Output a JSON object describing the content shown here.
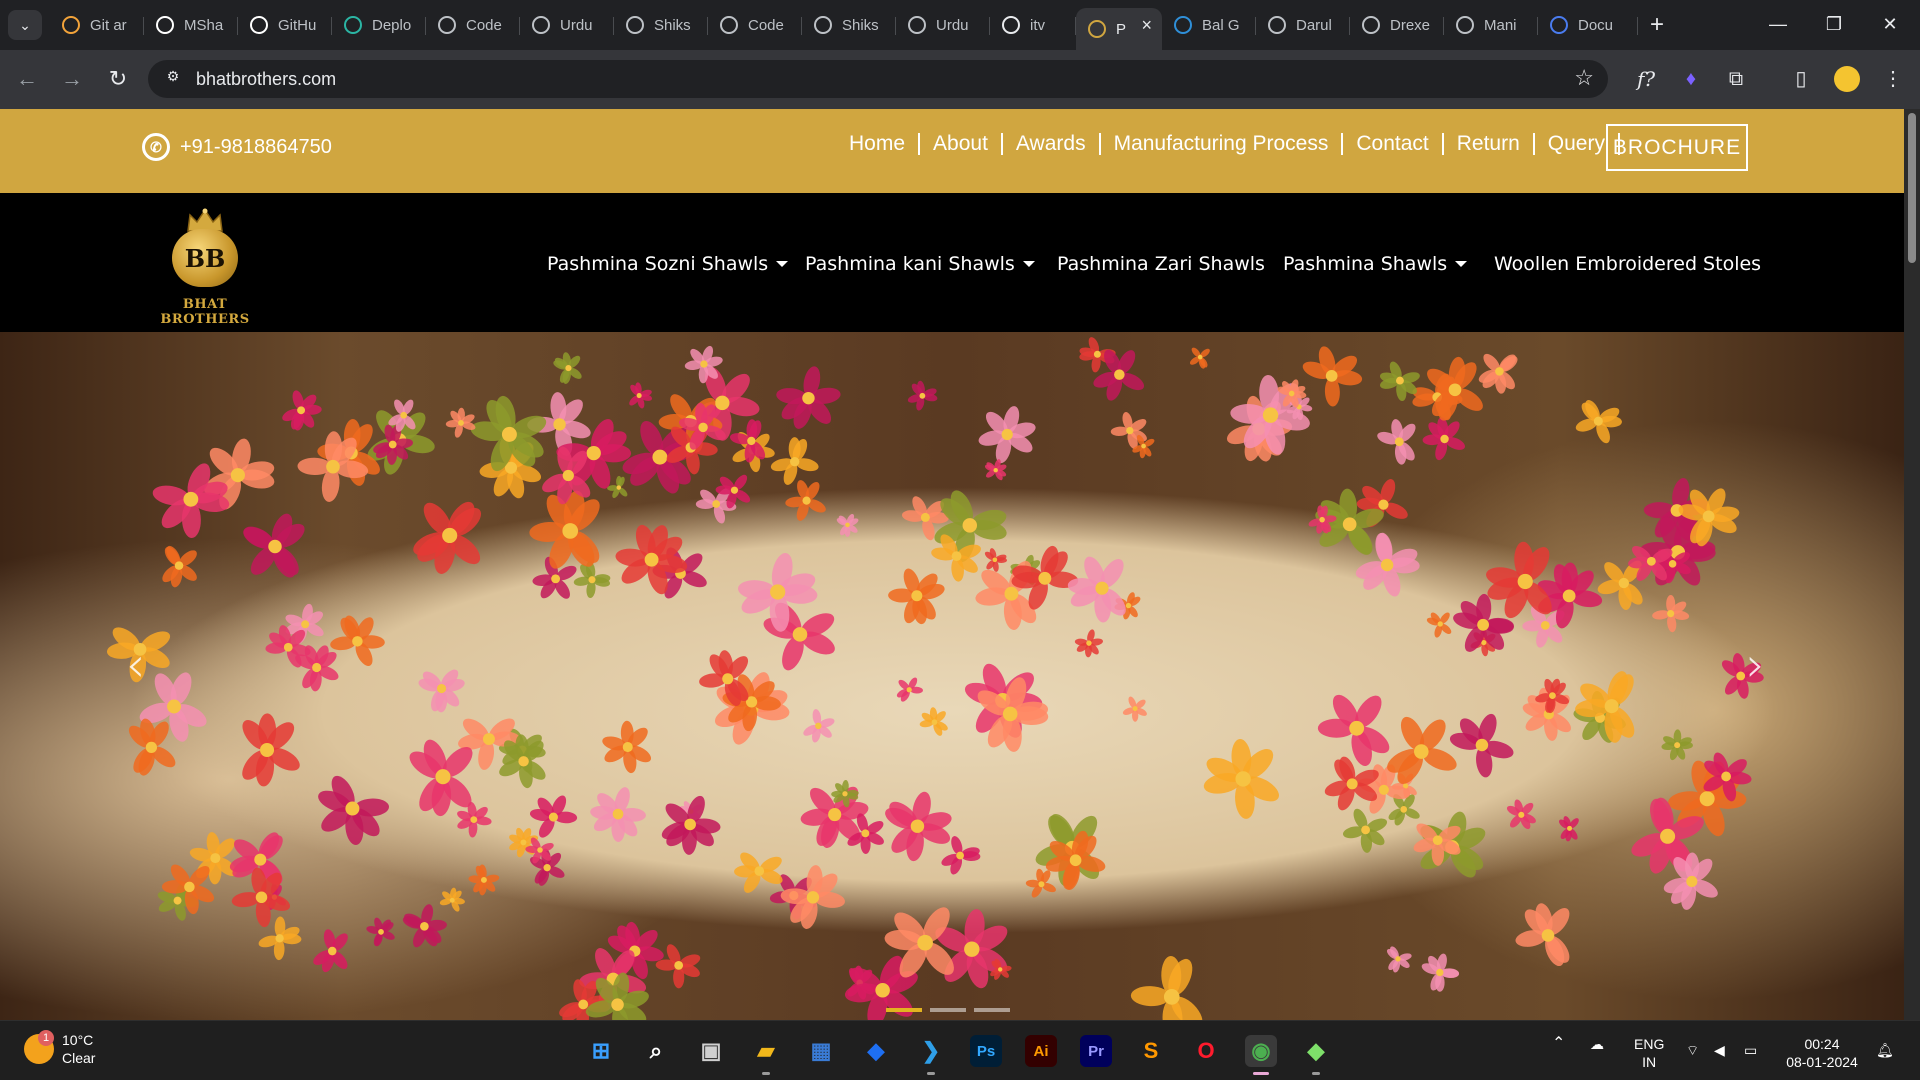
{
  "browser": {
    "tabs": [
      {
        "title": "Git ar",
        "icon": "code-braces-icon",
        "color": "#f2a33a"
      },
      {
        "title": "MSha",
        "icon": "github-icon",
        "color": "#ffffff"
      },
      {
        "title": "GitHu",
        "icon": "github-icon",
        "color": "#ffffff"
      },
      {
        "title": "Deplo",
        "icon": "deploy-icon",
        "color": "#2bb5a4"
      },
      {
        "title": "Code",
        "icon": "globe-icon",
        "color": "#bdc1c6"
      },
      {
        "title": "Urdu",
        "icon": "globe-icon",
        "color": "#bdc1c6"
      },
      {
        "title": "Shiks",
        "icon": "globe-icon",
        "color": "#bdc1c6"
      },
      {
        "title": "Code",
        "icon": "globe-icon",
        "color": "#bdc1c6"
      },
      {
        "title": "Shiks",
        "icon": "globe-icon",
        "color": "#bdc1c6"
      },
      {
        "title": "Urdu",
        "icon": "globe-icon",
        "color": "#bdc1c6"
      },
      {
        "title": "itv",
        "icon": "itv-icon",
        "color": "#e8eaed"
      },
      {
        "title": "P",
        "icon": "bhat-brothers-icon",
        "color": "#d0a640",
        "active": true
      },
      {
        "title": "Bal G",
        "icon": "bal-icon",
        "color": "#2f8fd8"
      },
      {
        "title": "Darul",
        "icon": "globe-icon",
        "color": "#bdc1c6"
      },
      {
        "title": "Drexe",
        "icon": "globe-icon",
        "color": "#bdc1c6"
      },
      {
        "title": "Mani",
        "icon": "globe-icon",
        "color": "#bdc1c6"
      },
      {
        "title": "Docu",
        "icon": "docs-icon",
        "color": "#4a7cf0"
      }
    ],
    "url": "bhatbrothers.com"
  },
  "site": {
    "phone": "+91-9818864750",
    "top_links": [
      "Home",
      "About",
      "Awards",
      "Manufacturing Process",
      "Contact",
      "Return",
      "Query"
    ],
    "brochure": "BROCHURE",
    "brand_name": "BHAT BROTHERS",
    "logo_monogram": "BB",
    "menu": [
      {
        "label": "Pashmina Sozni Shawls",
        "dropdown": true
      },
      {
        "label": "Pashmina kani Shawls",
        "dropdown": true
      },
      {
        "label": "Pashmina Zari Shawls",
        "dropdown": false
      },
      {
        "label": "Pashmina Shawls",
        "dropdown": true
      },
      {
        "label": "Woollen Embroidered Stoles",
        "dropdown": false
      }
    ],
    "carousel": {
      "slide_count": 3,
      "active_index": 0
    },
    "colors": {
      "gold": "#d0a640",
      "indicator_active": "#e2b320"
    }
  },
  "taskbar": {
    "weather_temp": "10°C",
    "weather_desc": "Clear",
    "weather_badge": "1",
    "apps": [
      {
        "name": "start-icon",
        "label": ""
      },
      {
        "name": "search-icon",
        "label": ""
      },
      {
        "name": "task-view-icon",
        "label": ""
      },
      {
        "name": "file-explorer-icon",
        "label": ""
      },
      {
        "name": "store-icon",
        "label": ""
      },
      {
        "name": "dropbox-icon",
        "label": ""
      },
      {
        "name": "vscode-icon",
        "label": ""
      },
      {
        "name": "photoshop-icon",
        "label": "Ps"
      },
      {
        "name": "illustrator-icon",
        "label": "Ai"
      },
      {
        "name": "premiere-icon",
        "label": "Pr"
      },
      {
        "name": "sublime-icon",
        "label": ""
      },
      {
        "name": "opera-icon",
        "label": ""
      },
      {
        "name": "chrome-icon",
        "label": ""
      },
      {
        "name": "git-icon",
        "label": ""
      }
    ],
    "lang_top": "ENG",
    "lang_bottom": "IN",
    "time": "00:24",
    "date": "08-01-2024"
  }
}
